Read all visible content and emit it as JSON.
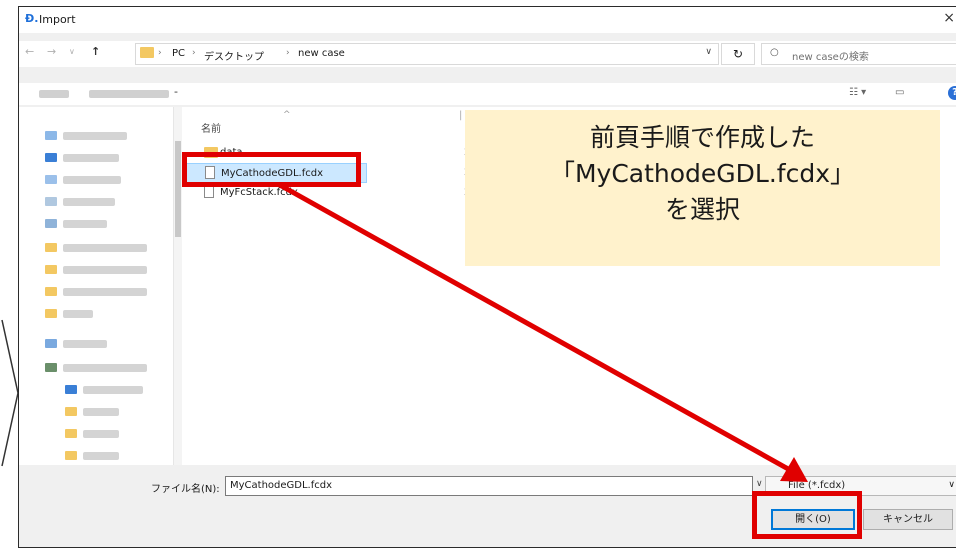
{
  "window": {
    "title": "Import",
    "close_glyph": "×"
  },
  "nav": {
    "breadcrumb": [
      "PC",
      "デスクトップ",
      "new case"
    ],
    "breadcrumb_sep": "›",
    "search_placeholder": "new caseの検索"
  },
  "file_list": {
    "column_name": "名前",
    "rows": [
      {
        "name": "data",
        "type": "folder",
        "selected": false
      },
      {
        "name": "MyCathodeGDL.fcdx",
        "type": "file",
        "selected": true
      },
      {
        "name": "MyFcStack.fcdx",
        "type": "file",
        "selected": false
      }
    ]
  },
  "bottom": {
    "filename_label": "ファイル名(N):",
    "filename_value": "MyCathodeGDL.fcdx",
    "filter_value": "File (*.fcdx)",
    "open_label": "開く(O)",
    "cancel_label": "キャンセル"
  },
  "annotation": {
    "lines": [
      "前頁手順で作成した",
      "「MyCathodeGDL.fcdx」",
      "を選択"
    ],
    "highlight_color": "#e00000",
    "callout_color": "#fff2cc"
  },
  "icons": {
    "app": "app-icon",
    "back": "back-arrow-icon",
    "forward": "forward-arrow-icon",
    "up": "up-arrow-icon",
    "refresh": "refresh-icon",
    "search": "search-icon",
    "help": "help-icon",
    "folder": "folder-icon",
    "file": "file-icon"
  }
}
